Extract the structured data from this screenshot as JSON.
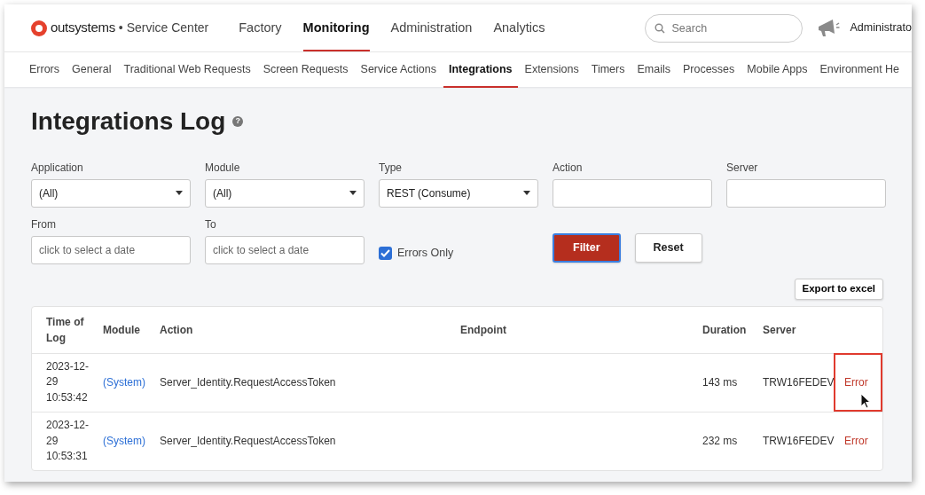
{
  "header": {
    "logo_text": "outsystems",
    "product": "• Service Center",
    "nav": [
      {
        "label": "Factory",
        "selected": false
      },
      {
        "label": "Monitoring",
        "selected": true
      },
      {
        "label": "Administration",
        "selected": false
      },
      {
        "label": "Analytics",
        "selected": false
      }
    ],
    "search": {
      "placeholder": "Search"
    },
    "user": "Administrato"
  },
  "subnav": [
    {
      "label": "Errors",
      "selected": false
    },
    {
      "label": "General",
      "selected": false
    },
    {
      "label": "Traditional Web Requests",
      "selected": false
    },
    {
      "label": "Screen Requests",
      "selected": false
    },
    {
      "label": "Service Actions",
      "selected": false
    },
    {
      "label": "Integrations",
      "selected": true
    },
    {
      "label": "Extensions",
      "selected": false
    },
    {
      "label": "Timers",
      "selected": false
    },
    {
      "label": "Emails",
      "selected": false
    },
    {
      "label": "Processes",
      "selected": false
    },
    {
      "label": "Mobile Apps",
      "selected": false
    },
    {
      "label": "Environment He",
      "selected": false
    }
  ],
  "page": {
    "title": "Integrations Log",
    "help": "?"
  },
  "filters": [
    {
      "kind": "select",
      "label": "Application",
      "value": "(All)"
    },
    {
      "kind": "select",
      "label": "Module",
      "value": "(All)"
    },
    {
      "kind": "select",
      "label": "Type",
      "value": "REST (Consume)"
    },
    {
      "kind": "text",
      "label": "Action"
    },
    {
      "kind": "text",
      "label": "Server"
    },
    {
      "kind": "date",
      "label": "From",
      "placeholder": "click to select a date"
    },
    {
      "kind": "date",
      "label": "To",
      "placeholder": "click to select a date"
    },
    {
      "kind": "checkbox",
      "label": "Errors Only",
      "checked": true
    },
    {
      "kind": "buttons",
      "buttons": [
        {
          "label": "Filter",
          "primary": true
        },
        {
          "label": "Reset",
          "primary": false
        }
      ]
    }
  ],
  "export_button": "Export to excel",
  "table": {
    "columns": [
      "Time of Log",
      "Module",
      "Action",
      "Endpoint",
      "Duration",
      "Server"
    ],
    "rows": [
      {
        "time": "2023-12-29 10:53:42",
        "module": "(System)",
        "action": "Server_Identity.RequestAccessToken",
        "endpoint": "",
        "duration": "143 ms",
        "server": "TRW16FEDEV",
        "status": "Error",
        "highlighted": true
      },
      {
        "time": "2023-12-29 10:53:31",
        "module": "(System)",
        "action": "Server_Identity.RequestAccessToken",
        "endpoint": "",
        "duration": "232 ms",
        "server": "TRW16FEDEV",
        "status": "Error",
        "highlighted": false
      }
    ]
  }
}
